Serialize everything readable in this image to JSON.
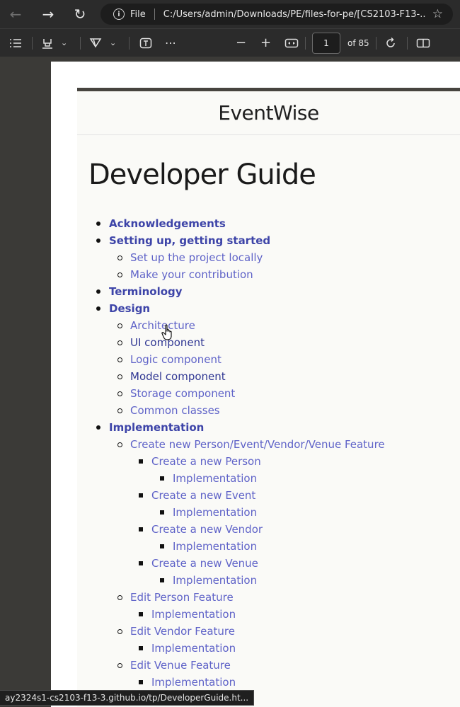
{
  "browser": {
    "file_label": "File",
    "url": "C:/Users/admin/Downloads/PE/files-for-pe/[CS2103-F13-..."
  },
  "pdf_toolbar": {
    "page_number": "1",
    "page_total": "of 85"
  },
  "document": {
    "site_title": "EventWise",
    "heading": "Developer Guide",
    "toc": [
      {
        "label": "Acknowledgements",
        "level": 0
      },
      {
        "label": "Setting up, getting started",
        "level": 0
      },
      {
        "label": "Set up the project locally",
        "level": 1
      },
      {
        "label": "Make your contribution",
        "level": 1
      },
      {
        "label": "Terminology",
        "level": 0
      },
      {
        "label": "Design",
        "level": 0
      },
      {
        "label": "Architecture",
        "level": 1
      },
      {
        "label": "UI component",
        "level": 1,
        "visited": true
      },
      {
        "label": "Logic component",
        "level": 1
      },
      {
        "label": "Model component",
        "level": 1,
        "visited": true
      },
      {
        "label": "Storage component",
        "level": 1
      },
      {
        "label": "Common classes",
        "level": 1
      },
      {
        "label": "Implementation",
        "level": 0
      },
      {
        "label": "Create new Person/Event/Vendor/Venue Feature",
        "level": 1
      },
      {
        "label": "Create a new Person",
        "level": 2
      },
      {
        "label": "Implementation",
        "level": 3
      },
      {
        "label": "Create a new Event",
        "level": 2
      },
      {
        "label": "Implementation",
        "level": 3
      },
      {
        "label": "Create a new Vendor",
        "level": 2
      },
      {
        "label": "Implementation",
        "level": 3
      },
      {
        "label": "Create a new Venue",
        "level": 2
      },
      {
        "label": "Implementation",
        "level": 3
      },
      {
        "label": "Edit Person Feature",
        "level": 1
      },
      {
        "label": "Implementation",
        "level": 2
      },
      {
        "label": "Edit Vendor Feature",
        "level": 1
      },
      {
        "label": "Implementation",
        "level": 2
      },
      {
        "label": "Edit Venue Feature",
        "level": 1
      },
      {
        "label": "Implementation",
        "level": 2
      }
    ]
  },
  "status_bar": {
    "link_url": "ay2324s1-cs2103-f13-3.github.io/tp/DeveloperGuide.ht..."
  }
}
